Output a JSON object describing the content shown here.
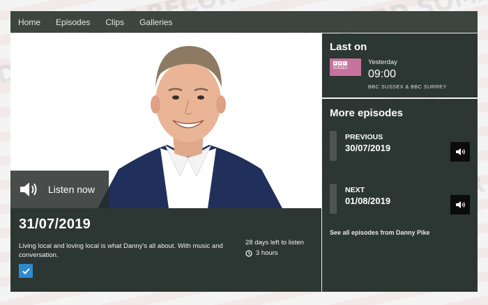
{
  "nav": {
    "items": [
      "Home",
      "Episodes",
      "Clips",
      "Galleries"
    ]
  },
  "hero": {
    "listen_label": "Listen now"
  },
  "episode": {
    "date": "31/07/2019",
    "description": "Living local and loving local is what Danny's all about. With music and conversation.",
    "days_left": "28 days left to listen",
    "duration": "3 hours"
  },
  "last_on": {
    "title": "Last on",
    "logo_lines": [
      "SUSSEX"
    ],
    "when": "Yesterday",
    "time": "09:00",
    "station": "BBC SUSSEX & BBC SURREY"
  },
  "more_episodes": {
    "title": "More episodes",
    "previous_label": "PREVIOUS",
    "previous_date": "30/07/2019",
    "next_label": "NEXT",
    "next_date": "01/08/2019",
    "all_link": "See all episodes from Danny Pike"
  },
  "colors": {
    "panel": "#2c3632",
    "nav": "#3d4541",
    "accent_check": "#2f8bd0",
    "logo": "#c7749c"
  }
}
